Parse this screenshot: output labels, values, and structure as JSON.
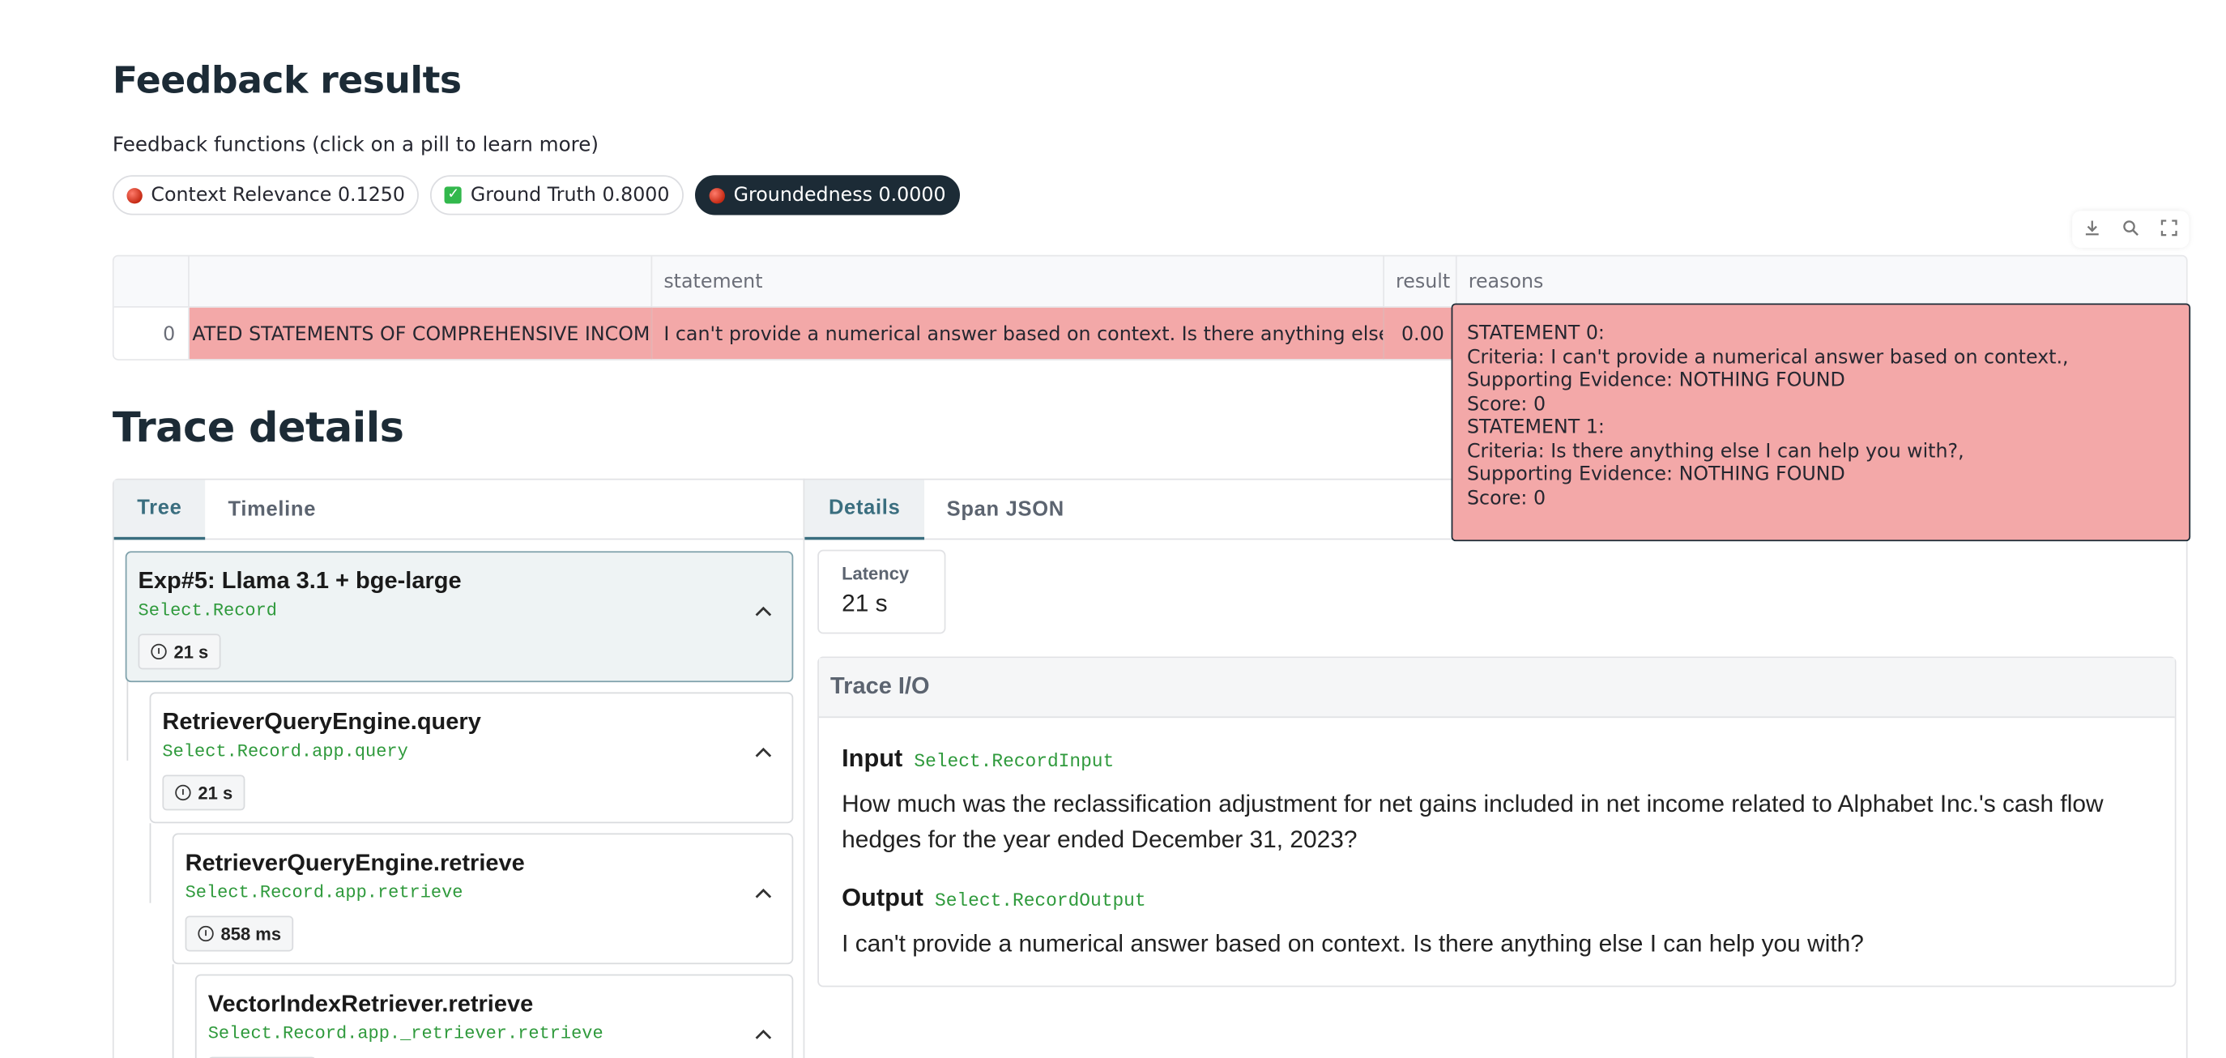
{
  "feedback": {
    "heading": "Feedback results",
    "caption": "Feedback functions (click on a pill to learn more)",
    "pills": [
      {
        "label": "Context Relevance 0.1250",
        "icon": "red-dot-icon"
      },
      {
        "label": "Ground Truth 0.8000",
        "icon": "green-check-icon"
      },
      {
        "label": "Groundedness 0.0000",
        "icon": "red-dot-icon"
      }
    ],
    "toolbar_icons": [
      "download-icon",
      "search-icon",
      "fullscreen-icon"
    ],
    "table": {
      "columns": [
        "",
        "statement",
        "result",
        "reasons"
      ],
      "rows": [
        {
          "index": "0",
          "source": "ATED STATEMENTS OF COMPREHENSIVE INCOME\\n'  '(In",
          "statement": "I can't provide a numerical answer based on context. Is there anything else I can help",
          "result": "0.00",
          "reasons": "STATEMENT 0:\nCriteria: I can't provide a numerical answer based on context.,\nSupporting Evidence: NOTHING FOUND\nScore: 0\nSTATEMENT 1:\nCriteria: Is there anything else I can help you with?,\nSupporting Evidence: NOTHING FOUND\nScore: 0"
        }
      ]
    }
  },
  "trace": {
    "heading": "Trace details",
    "left_tabs": [
      "Tree",
      "Timeline"
    ],
    "right_tabs": [
      "Details",
      "Span JSON"
    ],
    "nodes": [
      {
        "title": "Exp#5: Llama 3.1 + bge-large",
        "selector": "Select.Record",
        "duration": "21 s"
      },
      {
        "title": "RetrieverQueryEngine.query",
        "selector": "Select.Record.app.query",
        "duration": "21 s"
      },
      {
        "title": "RetrieverQueryEngine.retrieve",
        "selector": "Select.Record.app.retrieve",
        "duration": "858 ms"
      },
      {
        "title": "VectorIndexRetriever.retrieve",
        "selector": "Select.Record.app._retriever.retrieve",
        "duration": ""
      }
    ],
    "latency": {
      "label": "Latency",
      "value": "21 s"
    },
    "io": {
      "heading": "Trace I/O",
      "input_label": "Input",
      "input_selector": "Select.RecordInput",
      "input_text": "How much was the reclassification adjustment for net gains included in net income related to Alphabet Inc.'s cash flow hedges for the year ended December 31, 2023?",
      "output_label": "Output",
      "output_selector": "Select.RecordOutput",
      "output_text": "I can't provide a numerical answer based on context. Is there anything else I can help you with?"
    }
  },
  "colors": {
    "accent": "#3a6e7f",
    "dark_pill": "#1c2b36",
    "row_highlight": "#f3a8a8",
    "selector_green": "#2f9a3c"
  }
}
